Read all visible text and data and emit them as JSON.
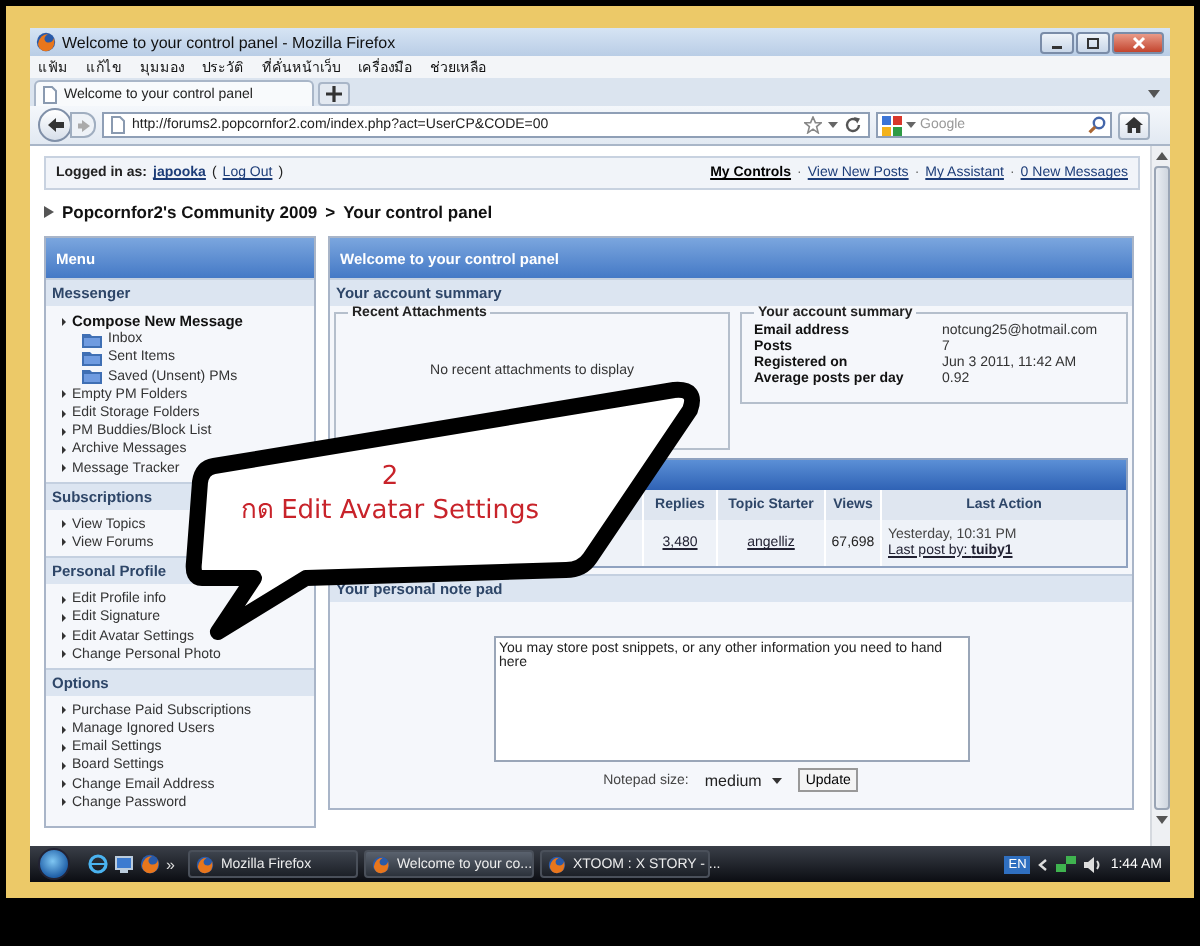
{
  "window": {
    "title": "Welcome to your control panel - Mozilla Firefox"
  },
  "menu_bar": [
    "แฟ้ม",
    "แก้ไข",
    "มุมมอง",
    "ประวัติ",
    "ที่คั่นหน้าเว็บ",
    "เครื่องมือ",
    "ช่วยเหลือ"
  ],
  "tabs": [
    {
      "label": "Welcome to your control panel",
      "selected": true
    }
  ],
  "address_bar": {
    "value": "http://forums2.popcornfor2.com/index.php?act=UserCP&CODE=00"
  },
  "search": {
    "placeholder": "Google"
  },
  "user_bar": {
    "label": "Logged in as:",
    "username": "japooka",
    "open": "(",
    "logout": "Log Out",
    "close": ")",
    "separator": "·",
    "links": [
      {
        "label": "My Controls",
        "bold": true
      },
      {
        "label": "View New Posts",
        "bold": false
      },
      {
        "label": "My Assistant",
        "bold": false
      },
      {
        "label": "0 New Messages",
        "bold": false
      }
    ]
  },
  "breadcrumb": {
    "items": [
      "Popcornfor2's Community 2009",
      "Your control panel"
    ],
    "separator": ">"
  },
  "sidebar": {
    "title": "Menu",
    "sections": [
      {
        "title": "Messenger",
        "items": [
          {
            "label": "Compose New Message",
            "kind": "bold"
          },
          {
            "label": "Inbox",
            "kind": "folder"
          },
          {
            "label": "Sent Items",
            "kind": "folder"
          },
          {
            "label": "Saved (Unsent) PMs",
            "kind": "folder"
          },
          {
            "label": "Empty PM Folders",
            "kind": "link"
          },
          {
            "label": "Edit Storage Folders",
            "kind": "link"
          },
          {
            "label": "PM Buddies/Block List",
            "kind": "link"
          },
          {
            "label": "Archive Messages",
            "kind": "link"
          },
          {
            "label": "Message Tracker",
            "kind": "link"
          }
        ]
      },
      {
        "title": "Subscriptions",
        "items": [
          {
            "label": "View Topics",
            "kind": "link"
          },
          {
            "label": "View Forums",
            "kind": "link"
          }
        ]
      },
      {
        "title": "Personal Profile",
        "items": [
          {
            "label": "Edit Profile info",
            "kind": "link"
          },
          {
            "label": "Edit Signature",
            "kind": "link"
          },
          {
            "label": "Edit Avatar Settings",
            "kind": "link"
          },
          {
            "label": "Change Personal Photo",
            "kind": "link"
          }
        ]
      },
      {
        "title": "Options",
        "items": [
          {
            "label": "Purchase Paid Subscriptions",
            "kind": "link"
          },
          {
            "label": "Manage Ignored Users",
            "kind": "link"
          },
          {
            "label": "Email Settings",
            "kind": "link"
          },
          {
            "label": "Board Settings",
            "kind": "link"
          },
          {
            "label": "Change Email Address",
            "kind": "link"
          },
          {
            "label": "Change Password",
            "kind": "link"
          }
        ]
      }
    ]
  },
  "main": {
    "title": "Welcome to your control panel",
    "summary_heading": "Your account summary",
    "attachments": {
      "title": "Recent Attachments",
      "empty_message": "No recent attachments to display"
    },
    "account": {
      "title": "Your account summary",
      "rows": [
        {
          "label": "Email address",
          "value": "notcung25@hotmail.com"
        },
        {
          "label": "Posts",
          "value": "7"
        },
        {
          "label": "Registered on",
          "value": "Jun 3 2011, 11:42 AM"
        },
        {
          "label": "Average posts per day",
          "value": "0.92"
        }
      ]
    },
    "topics": {
      "columns": [
        "Replies",
        "Topic Starter",
        "Views",
        "Last Action"
      ],
      "rows": [
        {
          "replies": "3,480",
          "topic_starter": "angelliz",
          "views": "67,698",
          "last_action_time": "Yesterday, 10:31 PM",
          "last_post": "Last post by: **tuiby1**"
        }
      ]
    },
    "notepad": {
      "title": "Your personal note pad",
      "value": "You may store post snippets, or any other information you need to hand here",
      "size_label": "Notepad size:",
      "size_value": "medium",
      "button": "Update"
    }
  },
  "callout": {
    "lines": [
      "2",
      "กด Edit Avatar Settings"
    ]
  },
  "taskbar": {
    "overflow": "»",
    "tasks": [
      {
        "label": "Mozilla Firefox",
        "selected": false
      },
      {
        "label": "Welcome to your co...",
        "selected": true
      },
      {
        "label": "XTOOM : X STORY - ...",
        "selected": false
      }
    ],
    "language": "EN",
    "clock": "1:44 AM"
  }
}
